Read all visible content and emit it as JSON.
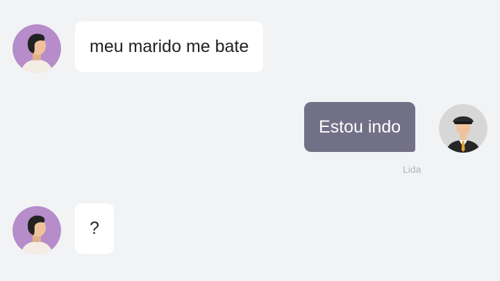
{
  "colors": {
    "background": "#f2f3f5",
    "incoming_bubble": "#ffffff",
    "outgoing_bubble": "#727087",
    "user_avatar_bg": "#b68cca",
    "driver_avatar_bg": "#d7d7d7"
  },
  "messages": [
    {
      "direction": "incoming",
      "text": "meu marido me bate",
      "avatar": "user-avatar"
    },
    {
      "direction": "outgoing",
      "text": "Estou indo",
      "avatar": "driver-avatar",
      "receipt": "Lida"
    },
    {
      "direction": "incoming",
      "text": "?",
      "avatar": "user-avatar"
    }
  ]
}
